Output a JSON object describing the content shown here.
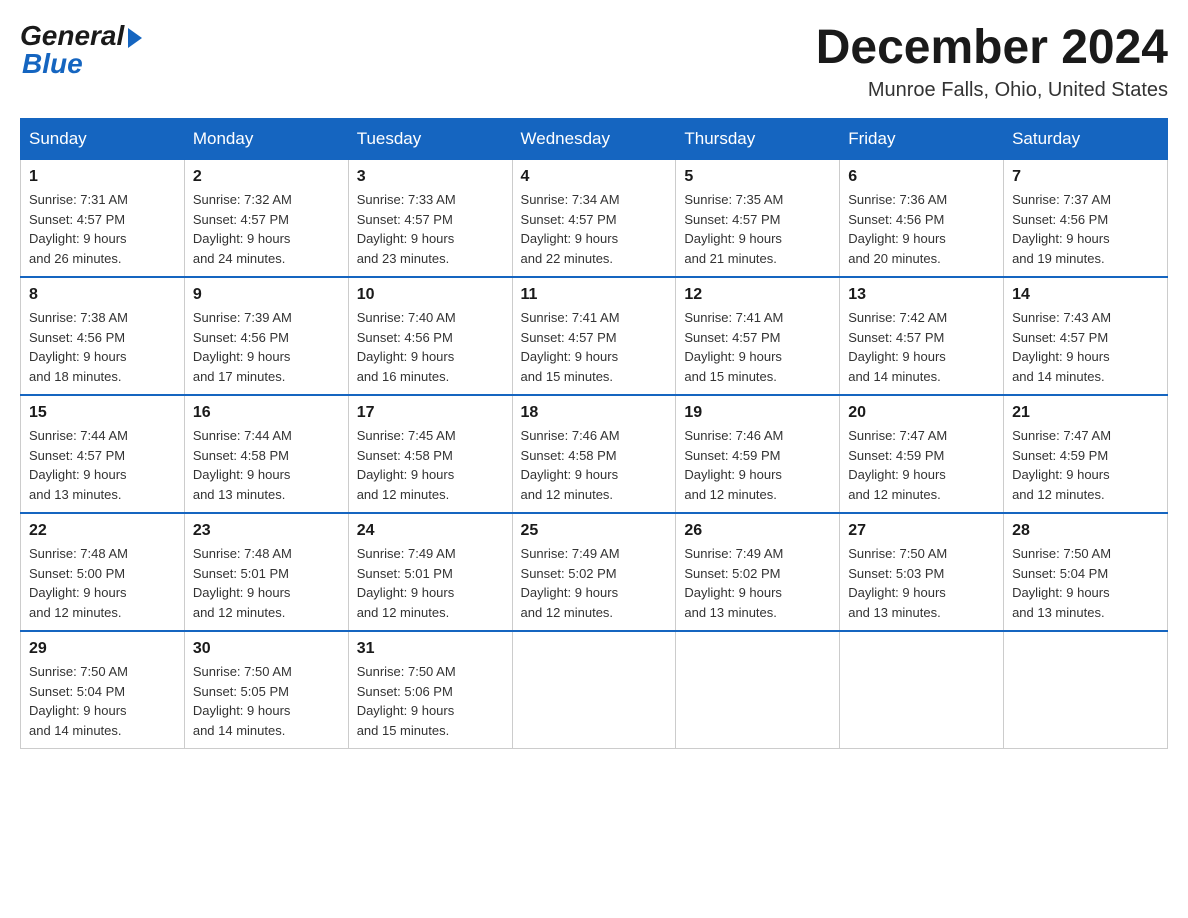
{
  "logo": {
    "general": "General",
    "blue": "Blue"
  },
  "title": {
    "month_year": "December 2024",
    "location": "Munroe Falls, Ohio, United States"
  },
  "headers": [
    "Sunday",
    "Monday",
    "Tuesday",
    "Wednesday",
    "Thursday",
    "Friday",
    "Saturday"
  ],
  "weeks": [
    [
      {
        "day": "1",
        "sunrise": "7:31 AM",
        "sunset": "4:57 PM",
        "daylight": "9 hours and 26 minutes."
      },
      {
        "day": "2",
        "sunrise": "7:32 AM",
        "sunset": "4:57 PM",
        "daylight": "9 hours and 24 minutes."
      },
      {
        "day": "3",
        "sunrise": "7:33 AM",
        "sunset": "4:57 PM",
        "daylight": "9 hours and 23 minutes."
      },
      {
        "day": "4",
        "sunrise": "7:34 AM",
        "sunset": "4:57 PM",
        "daylight": "9 hours and 22 minutes."
      },
      {
        "day": "5",
        "sunrise": "7:35 AM",
        "sunset": "4:57 PM",
        "daylight": "9 hours and 21 minutes."
      },
      {
        "day": "6",
        "sunrise": "7:36 AM",
        "sunset": "4:56 PM",
        "daylight": "9 hours and 20 minutes."
      },
      {
        "day": "7",
        "sunrise": "7:37 AM",
        "sunset": "4:56 PM",
        "daylight": "9 hours and 19 minutes."
      }
    ],
    [
      {
        "day": "8",
        "sunrise": "7:38 AM",
        "sunset": "4:56 PM",
        "daylight": "9 hours and 18 minutes."
      },
      {
        "day": "9",
        "sunrise": "7:39 AM",
        "sunset": "4:56 PM",
        "daylight": "9 hours and 17 minutes."
      },
      {
        "day": "10",
        "sunrise": "7:40 AM",
        "sunset": "4:56 PM",
        "daylight": "9 hours and 16 minutes."
      },
      {
        "day": "11",
        "sunrise": "7:41 AM",
        "sunset": "4:57 PM",
        "daylight": "9 hours and 15 minutes."
      },
      {
        "day": "12",
        "sunrise": "7:41 AM",
        "sunset": "4:57 PM",
        "daylight": "9 hours and 15 minutes."
      },
      {
        "day": "13",
        "sunrise": "7:42 AM",
        "sunset": "4:57 PM",
        "daylight": "9 hours and 14 minutes."
      },
      {
        "day": "14",
        "sunrise": "7:43 AM",
        "sunset": "4:57 PM",
        "daylight": "9 hours and 14 minutes."
      }
    ],
    [
      {
        "day": "15",
        "sunrise": "7:44 AM",
        "sunset": "4:57 PM",
        "daylight": "9 hours and 13 minutes."
      },
      {
        "day": "16",
        "sunrise": "7:44 AM",
        "sunset": "4:58 PM",
        "daylight": "9 hours and 13 minutes."
      },
      {
        "day": "17",
        "sunrise": "7:45 AM",
        "sunset": "4:58 PM",
        "daylight": "9 hours and 12 minutes."
      },
      {
        "day": "18",
        "sunrise": "7:46 AM",
        "sunset": "4:58 PM",
        "daylight": "9 hours and 12 minutes."
      },
      {
        "day": "19",
        "sunrise": "7:46 AM",
        "sunset": "4:59 PM",
        "daylight": "9 hours and 12 minutes."
      },
      {
        "day": "20",
        "sunrise": "7:47 AM",
        "sunset": "4:59 PM",
        "daylight": "9 hours and 12 minutes."
      },
      {
        "day": "21",
        "sunrise": "7:47 AM",
        "sunset": "4:59 PM",
        "daylight": "9 hours and 12 minutes."
      }
    ],
    [
      {
        "day": "22",
        "sunrise": "7:48 AM",
        "sunset": "5:00 PM",
        "daylight": "9 hours and 12 minutes."
      },
      {
        "day": "23",
        "sunrise": "7:48 AM",
        "sunset": "5:01 PM",
        "daylight": "9 hours and 12 minutes."
      },
      {
        "day": "24",
        "sunrise": "7:49 AM",
        "sunset": "5:01 PM",
        "daylight": "9 hours and 12 minutes."
      },
      {
        "day": "25",
        "sunrise": "7:49 AM",
        "sunset": "5:02 PM",
        "daylight": "9 hours and 12 minutes."
      },
      {
        "day": "26",
        "sunrise": "7:49 AM",
        "sunset": "5:02 PM",
        "daylight": "9 hours and 13 minutes."
      },
      {
        "day": "27",
        "sunrise": "7:50 AM",
        "sunset": "5:03 PM",
        "daylight": "9 hours and 13 minutes."
      },
      {
        "day": "28",
        "sunrise": "7:50 AM",
        "sunset": "5:04 PM",
        "daylight": "9 hours and 13 minutes."
      }
    ],
    [
      {
        "day": "29",
        "sunrise": "7:50 AM",
        "sunset": "5:04 PM",
        "daylight": "9 hours and 14 minutes."
      },
      {
        "day": "30",
        "sunrise": "7:50 AM",
        "sunset": "5:05 PM",
        "daylight": "9 hours and 14 minutes."
      },
      {
        "day": "31",
        "sunrise": "7:50 AM",
        "sunset": "5:06 PM",
        "daylight": "9 hours and 15 minutes."
      },
      null,
      null,
      null,
      null
    ]
  ],
  "labels": {
    "sunrise": "Sunrise:",
    "sunset": "Sunset:",
    "daylight": "Daylight:"
  }
}
